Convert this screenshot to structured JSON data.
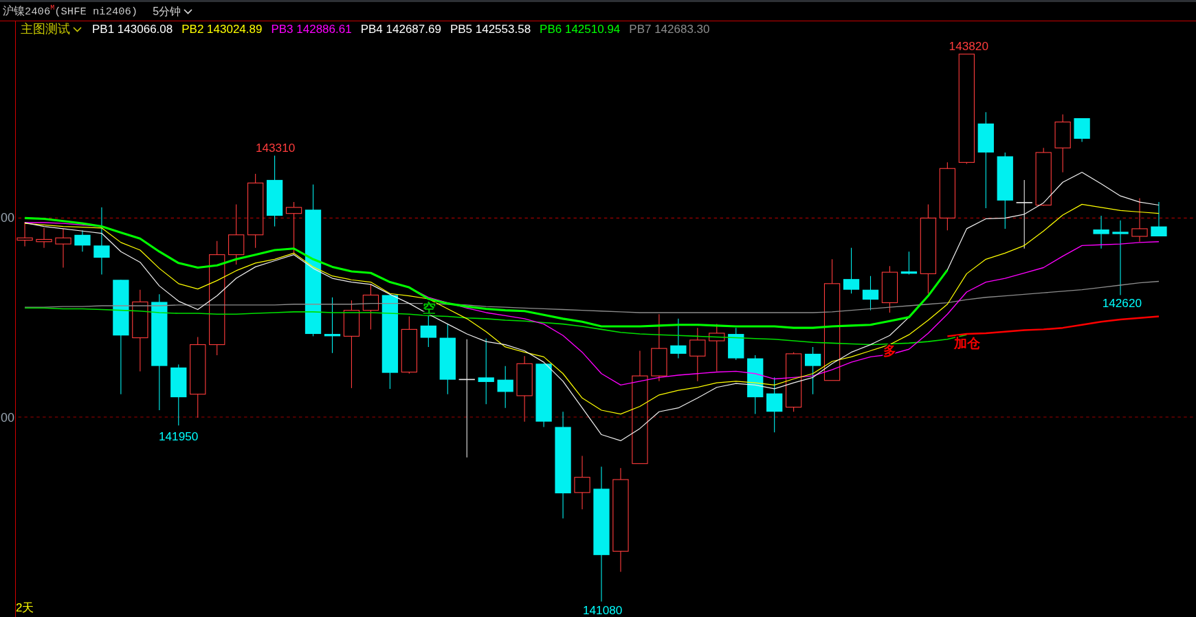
{
  "title_bar": {
    "instrument": "沪镍2406$^{M}$(SHFE ni2406)",
    "period": "5分钟"
  },
  "legend": {
    "indicator": "主图测试",
    "entries": [
      {
        "text": "PB1 143066.08",
        "color": "#ffffff"
      },
      {
        "text": "PB2 143024.89",
        "color": "#ffff00"
      },
      {
        "text": "PB3 142886.61",
        "color": "#ff00ff"
      },
      {
        "text": "PB4 142687.69",
        "color": "#ffffff"
      },
      {
        "text": "PB5 142553.58",
        "color": "#ffffff"
      },
      {
        "text": "PB6 142510.94",
        "color": "#00ff00"
      },
      {
        "text": "PB7 142683.30",
        "color": "#8c8c8c"
      }
    ]
  },
  "price_axis": {
    "labels": [
      "00",
      "00"
    ]
  },
  "chart": {
    "price_labels": [
      {
        "text": "141950",
        "color": "#00ffff"
      },
      {
        "text": "143310",
        "color": "#ff3c3c"
      },
      {
        "text": "141080",
        "color": "#00ffff"
      },
      {
        "text": "143820",
        "color": "#ff3c3c"
      },
      {
        "text": "142620",
        "color": "#00ffff"
      }
    ],
    "signals": [
      {
        "text": "空",
        "color": "#00c800"
      },
      {
        "text": "多",
        "color": "#ff0000"
      },
      {
        "text": "加仓",
        "color": "#ff0000"
      }
    ],
    "range": "2天"
  }
}
